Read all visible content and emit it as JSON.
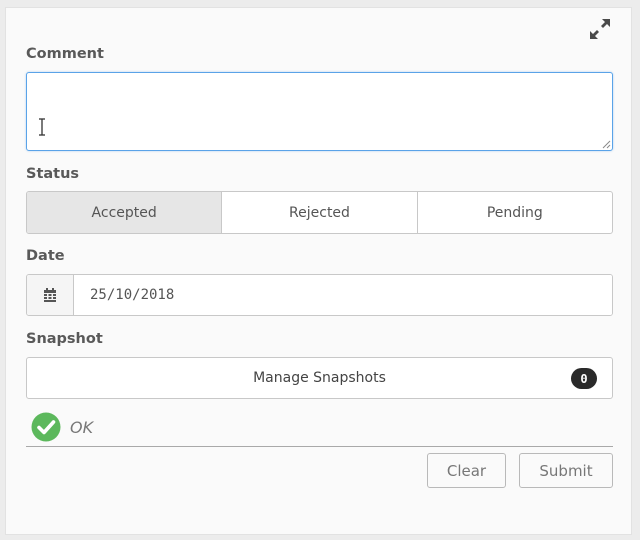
{
  "form": {
    "comment": {
      "label": "Comment",
      "value": "",
      "placeholder": ""
    },
    "status": {
      "label": "Status",
      "options": [
        "Accepted",
        "Rejected",
        "Pending"
      ],
      "selected": "Accepted"
    },
    "date": {
      "label": "Date",
      "value": "25/10/2018",
      "icon": "calendar-icon"
    },
    "snapshot": {
      "label": "Snapshot",
      "button_label": "Manage Snapshots",
      "count": "0"
    },
    "validation": {
      "icon": "check-circle-icon",
      "text": "OK",
      "color": "#5cb85c"
    },
    "actions": {
      "clear_label": "Clear",
      "submit_label": "Submit"
    }
  },
  "colors": {
    "focus_border": "#5aa3e8",
    "selected_option_bg": "#e6e6e6",
    "badge_bg": "#2a2a2a",
    "success": "#5cb85c"
  },
  "icons": {
    "expand": "expand-icon",
    "text_cursor": "text-cursor-icon",
    "resize": "resize-grip-icon"
  }
}
